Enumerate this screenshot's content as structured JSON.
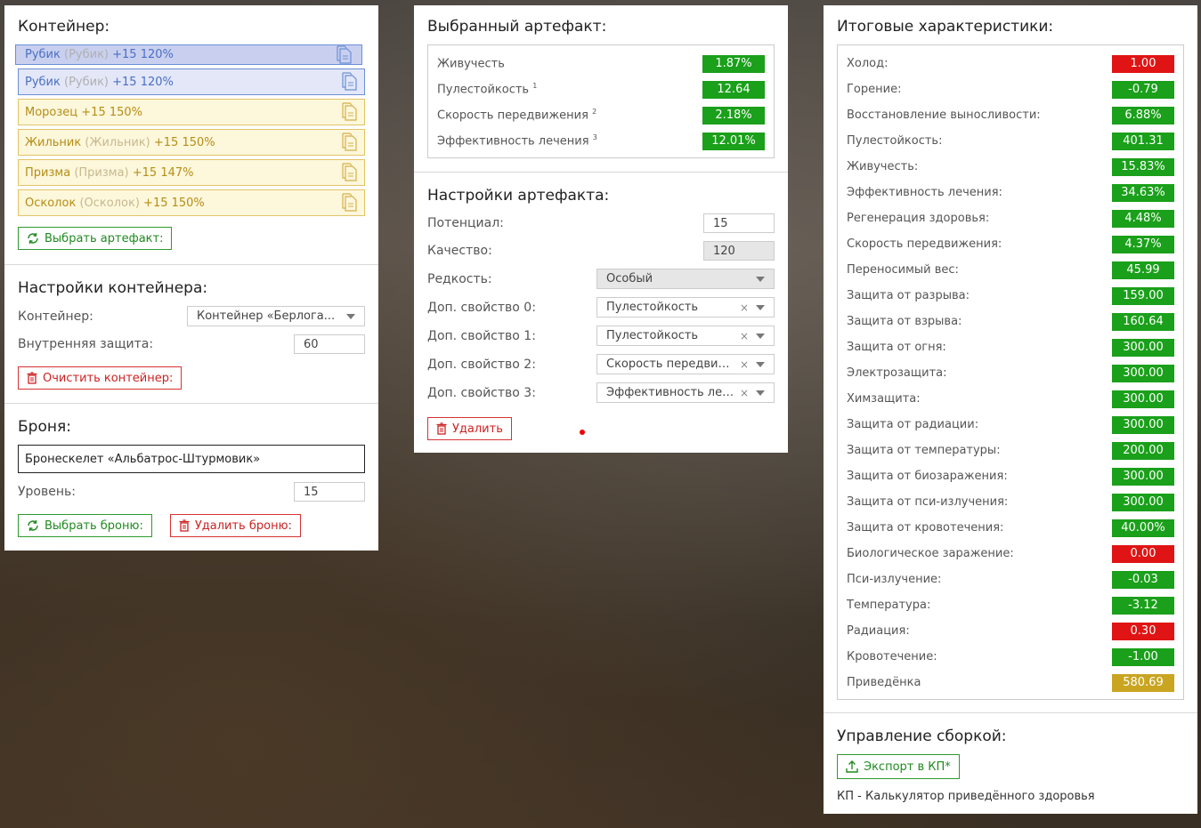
{
  "left": {
    "container_title": "Контейнер:",
    "artifacts": [
      {
        "name": "Рубик",
        "alt": "(Рубик)",
        "level": "+15 120%",
        "style": "blue-selected"
      },
      {
        "name": "Рубик",
        "alt": "(Рубик)",
        "level": "+15 120%",
        "style": "blue"
      },
      {
        "name": "Морозец",
        "alt": "",
        "level": "+15 150%",
        "style": "yellow"
      },
      {
        "name": "Жильник",
        "alt": "(Жильник)",
        "level": "+15 150%",
        "style": "yellow"
      },
      {
        "name": "Призма",
        "alt": "(Призма)",
        "level": "+15 147%",
        "style": "yellow"
      },
      {
        "name": "Осколок",
        "alt": "(Осколок)",
        "level": "+15 150%",
        "style": "yellow"
      }
    ],
    "choose_artifact_label": "Выбрать артефакт:",
    "container_settings_title": "Настройки контейнера:",
    "container_label": "Контейнер:",
    "container_value": "Контейнер «Берлога...",
    "inner_protection_label": "Внутренняя защита:",
    "inner_protection_value": "60",
    "clear_container_label": "Очистить контейнер:",
    "armor_title": "Броня:",
    "armor_value": "Бронескелет «Альбатрос-Штурмовик»",
    "level_label": "Уровень:",
    "level_value": "15",
    "choose_armor_label": "Выбрать броню:",
    "delete_armor_label": "Удалить броню:"
  },
  "middle": {
    "selected_title": "Выбранный артефакт:",
    "stats": [
      {
        "label": "Живучесть",
        "sup": "",
        "value": "1.87%"
      },
      {
        "label": "Пулестойкость",
        "sup": "1",
        "value": "12.64"
      },
      {
        "label": "Скорость передвижения",
        "sup": "2",
        "value": "2.18%"
      },
      {
        "label": "Эффективность лечения",
        "sup": "3",
        "value": "12.01%"
      }
    ],
    "settings_title": "Настройки артефакта:",
    "potential_label": "Потенциал:",
    "potential_value": "15",
    "quality_label": "Качество:",
    "quality_value": "120",
    "rarity_label": "Редкость:",
    "rarity_value": "Особый",
    "extra0_label": "Доп. свойство 0:",
    "extra0_value": "Пулестойкость",
    "extra1_label": "Доп. свойство 1:",
    "extra1_value": "Пулестойкость",
    "extra2_label": "Доп. свойство 2:",
    "extra2_value": "Скорость передвижения",
    "extra3_label": "Доп. свойство 3:",
    "extra3_value": "Эффективность лечения",
    "clear_x": "×",
    "delete_label": "Удалить"
  },
  "right": {
    "totals_title": "Итоговые характеристики:",
    "totals": [
      {
        "label": "Холод:",
        "value": "1.00",
        "color": "red"
      },
      {
        "label": "Горение:",
        "value": "-0.79",
        "color": "green"
      },
      {
        "label": "Восстановление выносливости:",
        "value": "6.88%",
        "color": "green"
      },
      {
        "label": "Пулестойкость:",
        "value": "401.31",
        "color": "green"
      },
      {
        "label": "Живучесть:",
        "value": "15.83%",
        "color": "green"
      },
      {
        "label": "Эффективность лечения:",
        "value": "34.63%",
        "color": "green"
      },
      {
        "label": "Регенерация здоровья:",
        "value": "4.48%",
        "color": "green"
      },
      {
        "label": "Скорость передвижения:",
        "value": "4.37%",
        "color": "green"
      },
      {
        "label": "Переносимый вес:",
        "value": "45.99",
        "color": "green"
      },
      {
        "label": "Защита от разрыва:",
        "value": "159.00",
        "color": "green"
      },
      {
        "label": "Защита от взрыва:",
        "value": "160.64",
        "color": "green"
      },
      {
        "label": "Защита от огня:",
        "value": "300.00",
        "color": "green"
      },
      {
        "label": "Электрозащита:",
        "value": "300.00",
        "color": "green"
      },
      {
        "label": "Химзащита:",
        "value": "300.00",
        "color": "green"
      },
      {
        "label": "Защита от радиации:",
        "value": "300.00",
        "color": "green"
      },
      {
        "label": "Защита от температуры:",
        "value": "200.00",
        "color": "green"
      },
      {
        "label": "Защита от биозаражения:",
        "value": "300.00",
        "color": "green"
      },
      {
        "label": "Защита от пси-излучения:",
        "value": "300.00",
        "color": "green"
      },
      {
        "label": "Защита от кровотечения:",
        "value": "40.00%",
        "color": "green"
      },
      {
        "label": "Биологическое заражение:",
        "value": "0.00",
        "color": "red"
      },
      {
        "label": "Пси-излучение:",
        "value": "-0.03",
        "color": "green"
      },
      {
        "label": "Температура:",
        "value": "-3.12",
        "color": "green"
      },
      {
        "label": "Радиация:",
        "value": "0.30",
        "color": "red"
      },
      {
        "label": "Кровотечение:",
        "value": "-1.00",
        "color": "green"
      },
      {
        "label": "Приведёнка",
        "value": "580.69",
        "color": "gold"
      }
    ],
    "build_title": "Управление сборкой:",
    "export_label": "Экспорт в КП*",
    "footnote": "КП - Калькулятор приведённого здоровья"
  },
  "colors": {
    "green": "#1aa01a",
    "red": "#e01414",
    "gold": "#c9a521",
    "accent_blue": "#6b8fd6"
  }
}
